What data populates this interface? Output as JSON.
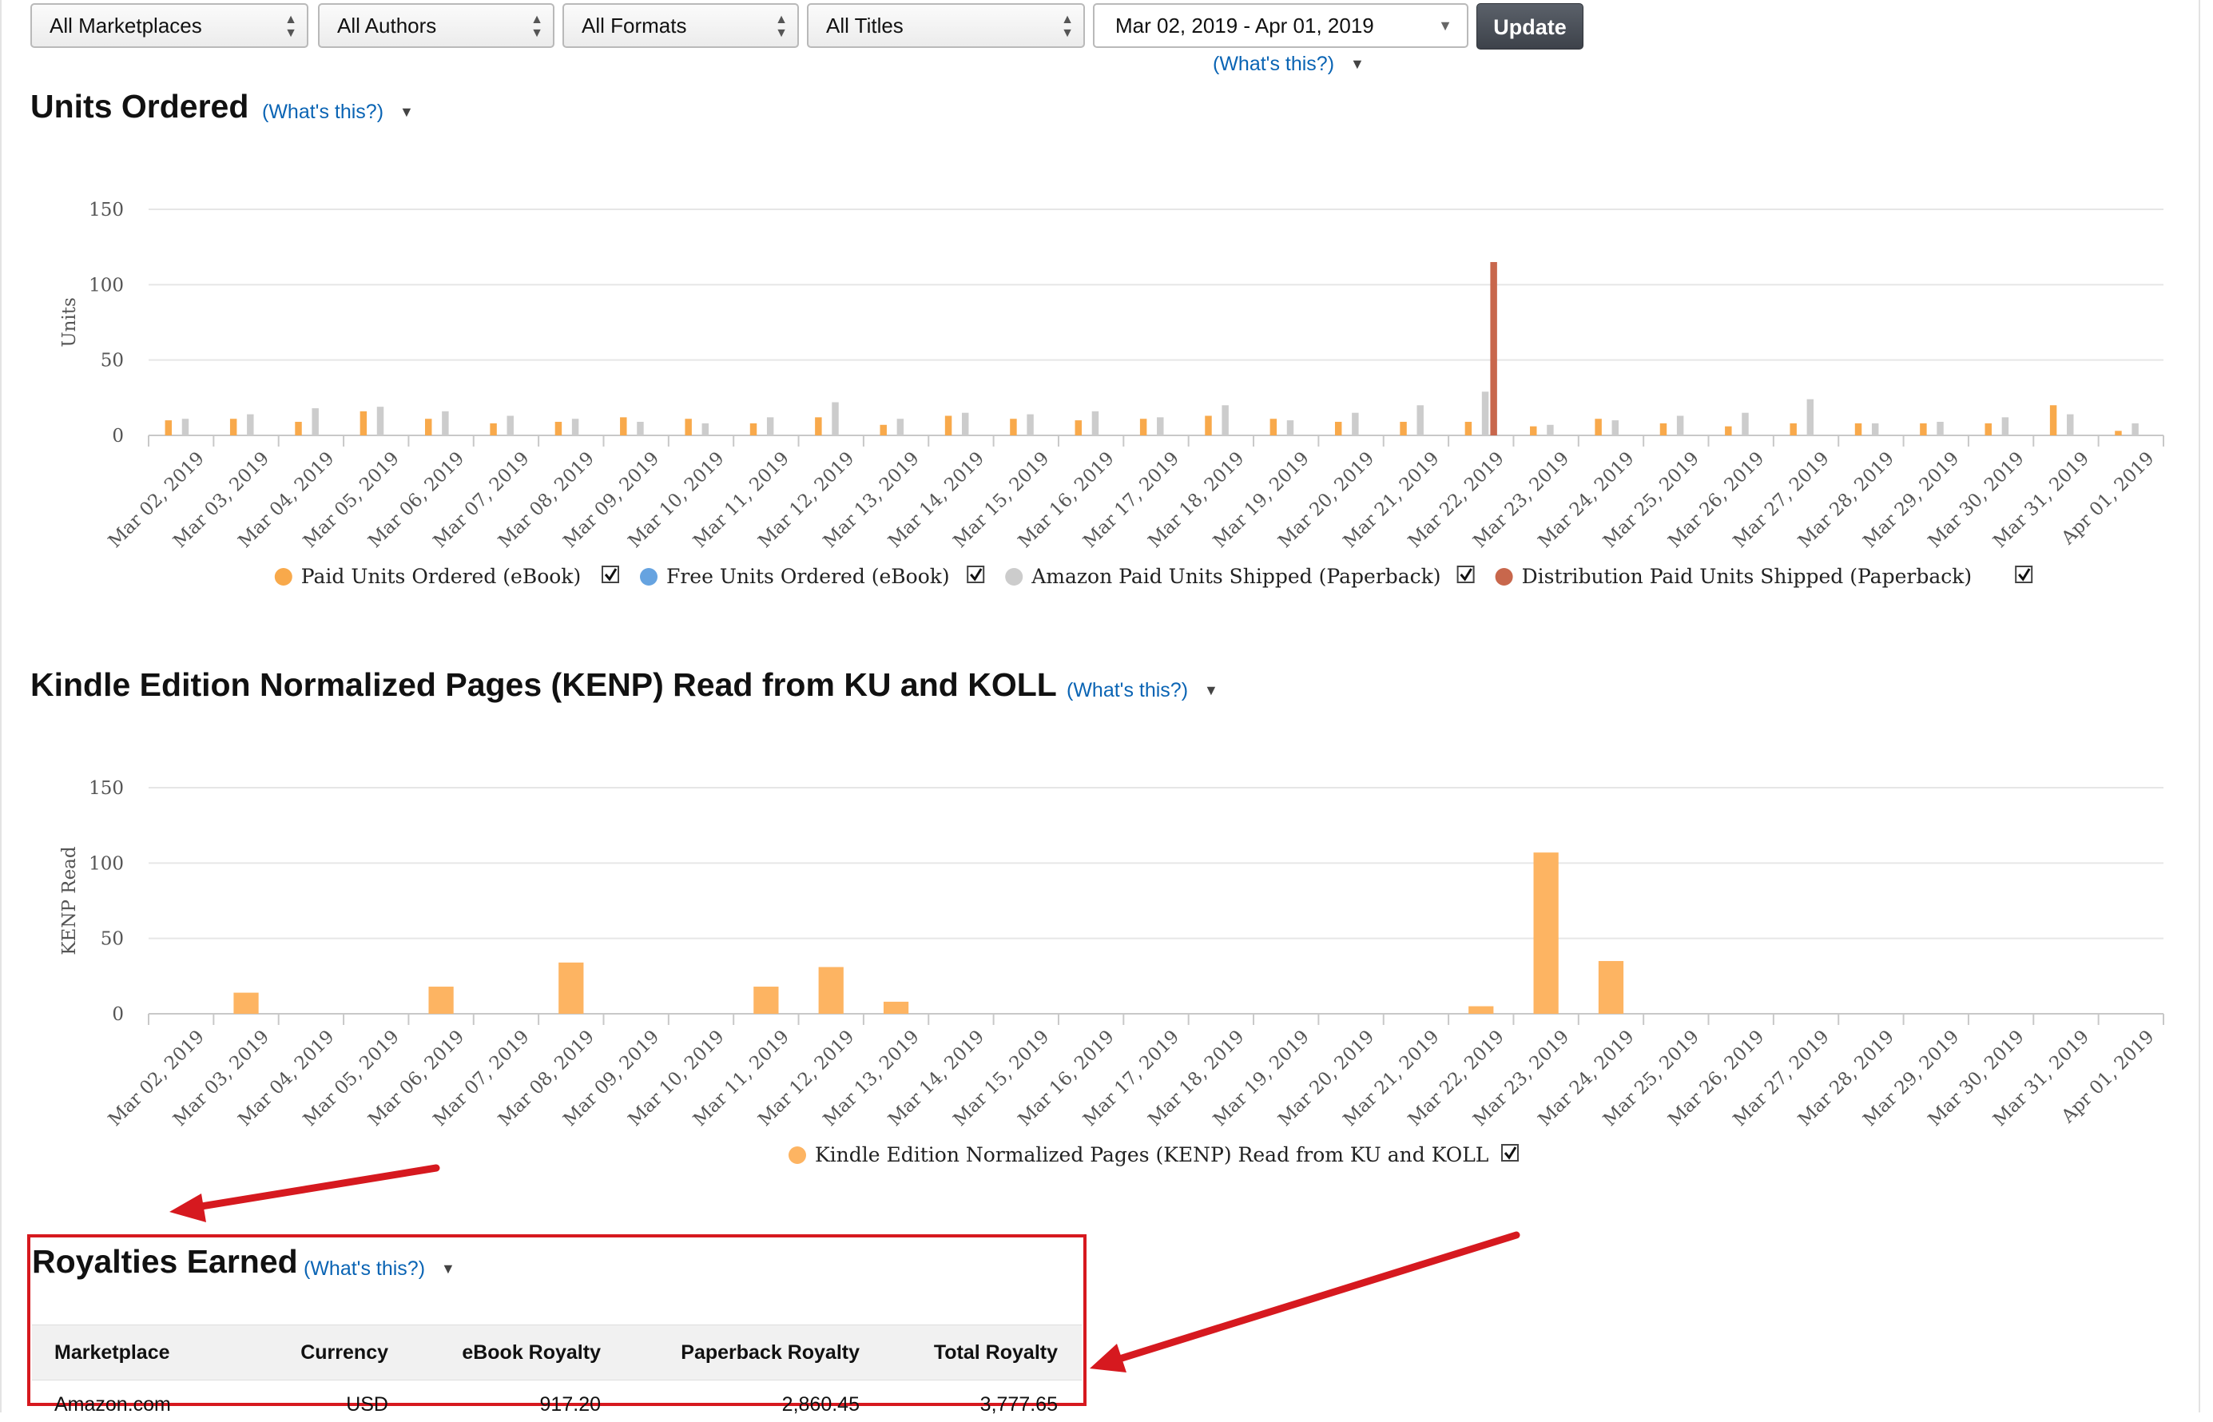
{
  "filters": {
    "marketplace": "All Marketplaces",
    "authors": "All Authors",
    "formats": "All Formats",
    "titles": "All Titles",
    "date_range": "Mar 02, 2019 - Apr 01, 2019",
    "update_label": "Update",
    "whats_this": "(What's this?)"
  },
  "units": {
    "title": "Units Ordered",
    "whats_this": "(What's this?)",
    "chart_data": {
      "type": "bar",
      "ylabel": "Units",
      "ylim": [
        0,
        150
      ],
      "yticks": [
        0,
        50,
        100,
        150
      ],
      "grid": true,
      "legend_position": "bottom",
      "categories": [
        "Mar 02, 2019",
        "Mar 03, 2019",
        "Mar 04, 2019",
        "Mar 05, 2019",
        "Mar 06, 2019",
        "Mar 07, 2019",
        "Mar 08, 2019",
        "Mar 09, 2019",
        "Mar 10, 2019",
        "Mar 11, 2019",
        "Mar 12, 2019",
        "Mar 13, 2019",
        "Mar 14, 2019",
        "Mar 15, 2019",
        "Mar 16, 2019",
        "Mar 17, 2019",
        "Mar 18, 2019",
        "Mar 19, 2019",
        "Mar 20, 2019",
        "Mar 21, 2019",
        "Mar 22, 2019",
        "Mar 23, 2019",
        "Mar 24, 2019",
        "Mar 25, 2019",
        "Mar 26, 2019",
        "Mar 27, 2019",
        "Mar 28, 2019",
        "Mar 29, 2019",
        "Mar 30, 2019",
        "Mar 31, 2019",
        "Apr 01, 2019"
      ],
      "series": [
        {
          "name": "Paid Units Ordered (eBook)",
          "color": "#f8a94b",
          "values": [
            10,
            11,
            9,
            16,
            11,
            8,
            9,
            12,
            11,
            8,
            12,
            7,
            13,
            11,
            10,
            11,
            13,
            11,
            9,
            9,
            9,
            6,
            11,
            8,
            6,
            8,
            8,
            8,
            8,
            20,
            3
          ]
        },
        {
          "name": "Free Units Ordered (eBook)",
          "color": "#66a3e0",
          "values": [
            0,
            0,
            0,
            0,
            0,
            0,
            0,
            0,
            0,
            0,
            0,
            0,
            0,
            0,
            0,
            0,
            0,
            0,
            0,
            0,
            0,
            0,
            0,
            0,
            0,
            0,
            0,
            0,
            0,
            0,
            0
          ]
        },
        {
          "name": "Amazon Paid Units Shipped (Paperback)",
          "color": "#cccccc",
          "values": [
            11,
            14,
            18,
            19,
            16,
            13,
            11,
            9,
            8,
            12,
            22,
            11,
            15,
            14,
            16,
            12,
            20,
            10,
            15,
            20,
            29,
            7,
            10,
            13,
            15,
            24,
            8,
            9,
            12,
            14,
            8
          ]
        },
        {
          "name": "Distribution Paid Units Shipped (Paperback)",
          "color": "#c8674c",
          "values": [
            0,
            0,
            0,
            0,
            0,
            0,
            0,
            0,
            0,
            0,
            0,
            0,
            0,
            0,
            0,
            0,
            0,
            0,
            0,
            0,
            115,
            0,
            0,
            0,
            0,
            0,
            0,
            0,
            0,
            0,
            0
          ]
        }
      ]
    }
  },
  "kenp": {
    "title": "Kindle Edition Normalized Pages (KENP) Read from KU and KOLL",
    "whats_this": "(What's this?)",
    "chart_data": {
      "type": "bar",
      "ylabel": "KENP Read",
      "ylim": [
        0,
        150
      ],
      "yticks": [
        0,
        50,
        100,
        150
      ],
      "grid": true,
      "legend_position": "bottom",
      "categories": [
        "Mar 02, 2019",
        "Mar 03, 2019",
        "Mar 04, 2019",
        "Mar 05, 2019",
        "Mar 06, 2019",
        "Mar 07, 2019",
        "Mar 08, 2019",
        "Mar 09, 2019",
        "Mar 10, 2019",
        "Mar 11, 2019",
        "Mar 12, 2019",
        "Mar 13, 2019",
        "Mar 14, 2019",
        "Mar 15, 2019",
        "Mar 16, 2019",
        "Mar 17, 2019",
        "Mar 18, 2019",
        "Mar 19, 2019",
        "Mar 20, 2019",
        "Mar 21, 2019",
        "Mar 22, 2019",
        "Mar 23, 2019",
        "Mar 24, 2019",
        "Mar 25, 2019",
        "Mar 26, 2019",
        "Mar 27, 2019",
        "Mar 28, 2019",
        "Mar 29, 2019",
        "Mar 30, 2019",
        "Mar 31, 2019",
        "Apr 01, 2019"
      ],
      "series": [
        {
          "name": "Kindle Edition Normalized Pages (KENP) Read from KU and KOLL",
          "color": "#fdb462",
          "values": [
            0,
            14,
            0,
            0,
            18,
            0,
            34,
            0,
            0,
            18,
            31,
            8,
            0,
            0,
            0,
            0,
            0,
            0,
            0,
            0,
            5,
            107,
            35,
            0,
            0,
            0,
            0,
            0,
            0,
            0,
            0
          ]
        }
      ]
    }
  },
  "royalties": {
    "title": "Royalties Earned",
    "whats_this": "(What's this?)",
    "columns": [
      "Marketplace",
      "Currency",
      "eBook Royalty",
      "Paperback Royalty",
      "Total Royalty"
    ],
    "rows": [
      [
        "Amazon.com",
        "USD",
        "917.20",
        "2,860.45",
        "3,777.65"
      ]
    ]
  },
  "colors": {
    "link": "#0a64b4",
    "annotation_red": "#d6191f"
  }
}
